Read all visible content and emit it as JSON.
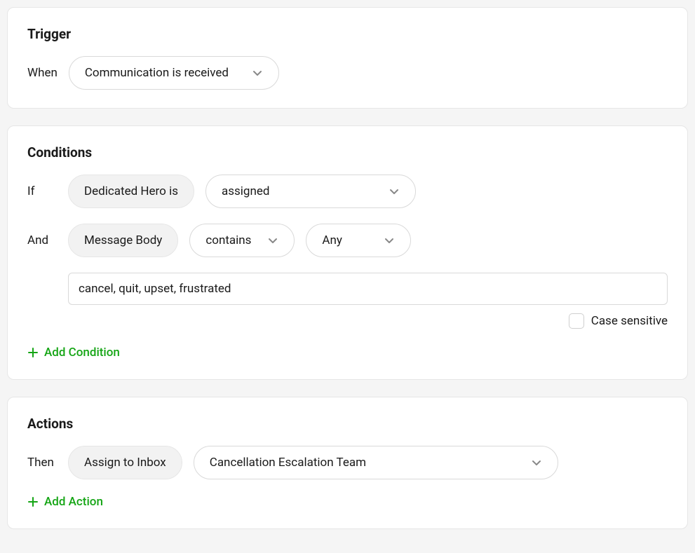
{
  "trigger": {
    "title": "Trigger",
    "when_label": "When",
    "event": "Communication is received"
  },
  "conditions": {
    "title": "Conditions",
    "if_label": "If",
    "and_label": "And",
    "cond1_field": "Dedicated Hero is",
    "cond1_value": "assigned",
    "cond2_field": "Message Body",
    "cond2_operator": "contains",
    "cond2_match": "Any",
    "cond2_keywords": "cancel, quit, upset, frustrated",
    "case_sensitive_label": "Case sensitive",
    "add_condition_label": "Add Condition"
  },
  "actions": {
    "title": "Actions",
    "then_label": "Then",
    "action_type": "Assign to Inbox",
    "action_target": "Cancellation Escalation Team",
    "add_action_label": "Add Action"
  }
}
